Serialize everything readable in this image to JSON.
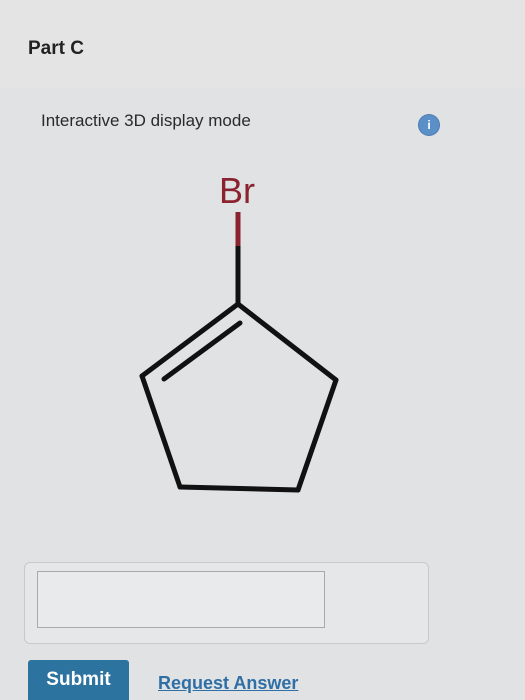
{
  "part": {
    "title": "Part C"
  },
  "viewer": {
    "mode_label": "Interactive 3D display mode",
    "info_icon": "info-icon",
    "info_glyph": "i"
  },
  "molecule": {
    "atom_label": "Br",
    "structure": "bromocyclopentene"
  },
  "answer": {
    "value": "",
    "placeholder": ""
  },
  "actions": {
    "submit_label": "Submit",
    "request_answer_label": "Request Answer"
  },
  "colors": {
    "submit_bg": "#2d73a0",
    "link": "#2f6fa5",
    "info": "#5b8fc8",
    "bromine": "#8b2230"
  }
}
